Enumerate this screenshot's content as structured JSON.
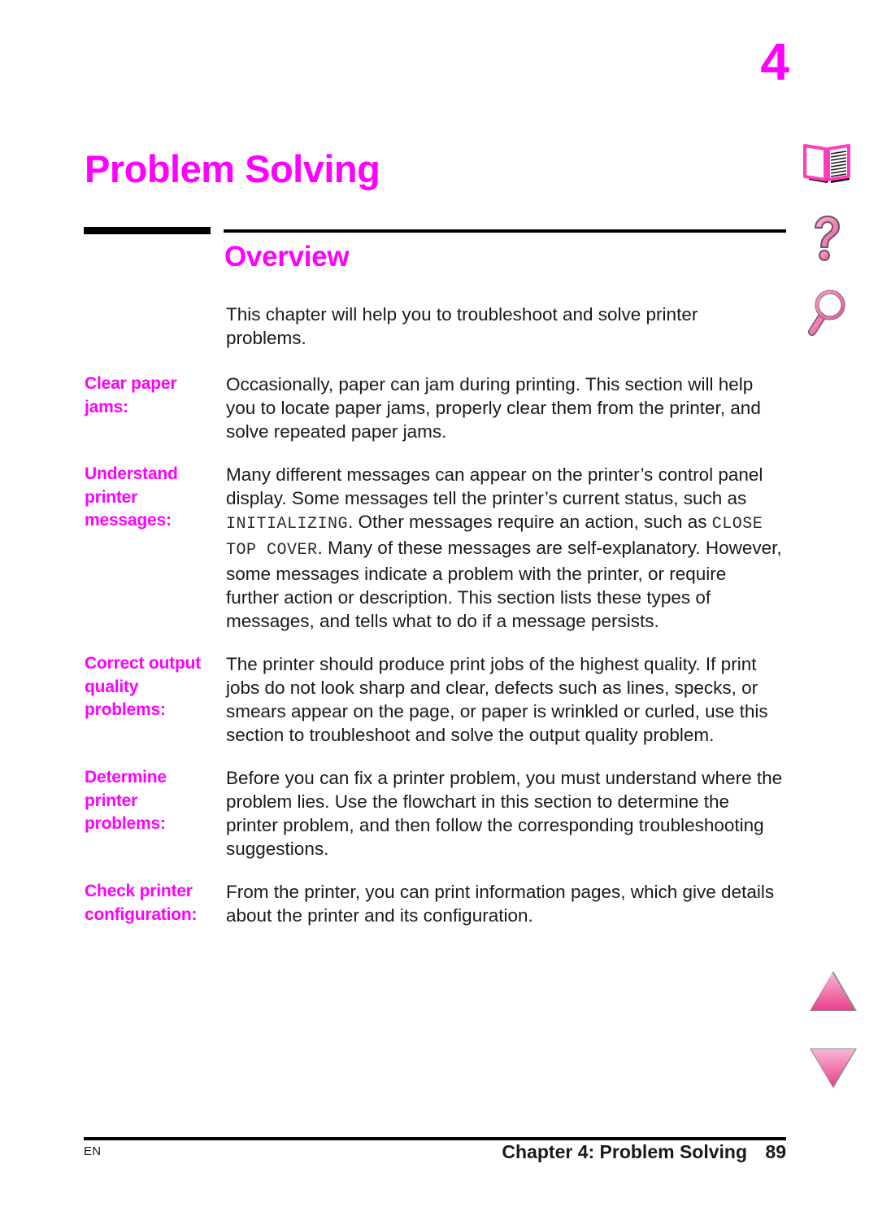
{
  "page": {
    "chapter_number": "4",
    "chapter_title": "Problem Solving",
    "section_heading": "Overview"
  },
  "intro": "This chapter will help you to troubleshoot and solve printer problems.",
  "definitions": [
    {
      "term": "Clear paper jams:",
      "description": "Occasionally, paper can jam during printing. This section will help you to locate paper jams, properly clear them from the printer, and solve repeated paper jams."
    },
    {
      "term": "Understand printer messages:",
      "desc_part1": "Many different messages can appear on the printer’s control panel display. Some messages tell the printer’s current status, such as ",
      "lcd_message_1": "INITIALIZING",
      "desc_part2": ". Other messages require an action, such as ",
      "lcd_message_2": "CLOSE TOP COVER",
      "desc_part3": ". Many of these messages are self-explanatory. However, some messages indicate a problem with the printer, or require further action or description. This section lists these types of messages, and tells what to do if a message persists."
    },
    {
      "term": "Correct output quality problems:",
      "description": "The printer should produce print jobs of the highest quality. If print jobs do not look sharp and clear, defects such as lines, specks, or smears appear on the page, or paper is wrinkled or curled, use this section to troubleshoot and solve the output quality problem."
    },
    {
      "term": "Determine printer problems:",
      "description": "Before you can fix a printer problem, you must understand where the problem lies. Use the flowchart in this section to determine the printer problem, and then follow the corresponding troubleshooting suggestions."
    },
    {
      "term": "Check printer configuration:",
      "description": "From the printer, you can print information pages, which give details about the printer and its configuration."
    }
  ],
  "nav_icons": [
    {
      "name": "open-book-icon",
      "label": "Table of contents"
    },
    {
      "name": "question-mark-icon",
      "label": "Help"
    },
    {
      "name": "magnifying-glass-icon",
      "label": "Search"
    },
    {
      "name": "triangle-up-icon",
      "label": "Previous page"
    },
    {
      "name": "triangle-down-icon",
      "label": "Next page"
    }
  ],
  "footer": {
    "language": "EN",
    "chapter_label": "Chapter 4:  Problem Solving",
    "page_number": "89"
  },
  "colors": {
    "accent_magenta": "#ff00ff",
    "icon_pink": "#ef5ba1",
    "icon_pink_light": "#f79fc6",
    "text_black": "#1a1a1a"
  }
}
